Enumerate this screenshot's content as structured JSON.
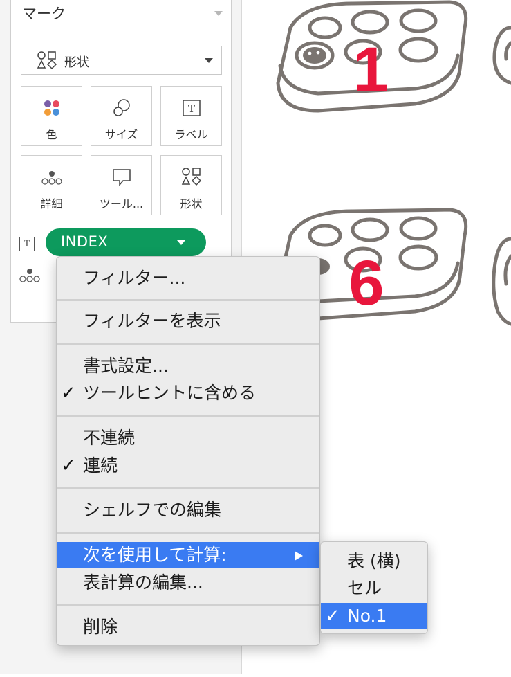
{
  "marks_card": {
    "title": "マーク",
    "mark_type": "形状",
    "buttons": [
      {
        "label": "色",
        "icon": "color-dots-icon"
      },
      {
        "label": "サイズ",
        "icon": "size-circles-icon"
      },
      {
        "label": "ラベル",
        "icon": "label-text-icon"
      },
      {
        "label": "詳細",
        "icon": "detail-dots-icon"
      },
      {
        "label": "ツール...",
        "icon": "tooltip-bubble-icon"
      },
      {
        "label": "形状",
        "icon": "shapes-icon"
      }
    ],
    "pill": {
      "label": "INDEX",
      "color": "#0d9a5d"
    }
  },
  "canvas": {
    "numbers": [
      "1",
      "6"
    ],
    "number_color": "#e8163c"
  },
  "context_menu": {
    "items": [
      {
        "label": "フィルター...",
        "checked": false
      },
      {
        "label": "フィルターを表示",
        "checked": false
      },
      {
        "label": "書式設定...",
        "checked": false
      },
      {
        "label": "ツールヒントに含める",
        "checked": true
      },
      {
        "label": "不連続",
        "checked": false
      },
      {
        "label": "連続",
        "checked": true
      },
      {
        "label": "シェルフでの編集",
        "checked": false
      },
      {
        "label": "次を使用して計算:",
        "checked": false,
        "selected": true,
        "has_submenu": true
      },
      {
        "label": "表計算の編集...",
        "checked": false
      },
      {
        "label": "削除",
        "checked": false
      }
    ],
    "check_glyph": "✓",
    "highlight_color": "#3a7bf2"
  },
  "submenu": {
    "items": [
      {
        "label": "表 (横)",
        "checked": false
      },
      {
        "label": "セル",
        "checked": false
      },
      {
        "label": "No.1",
        "checked": true,
        "selected": true
      }
    ]
  }
}
